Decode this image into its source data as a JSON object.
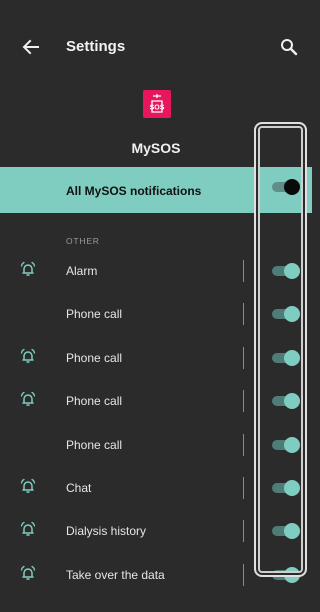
{
  "header": {
    "title": "Settings",
    "back_icon": "arrow-left-icon",
    "search_icon": "search-icon"
  },
  "app": {
    "name": "MySOS",
    "logo_text": "SOS",
    "logo_color": "#e8175d"
  },
  "master": {
    "label": "All MySOS notifications",
    "enabled": true,
    "background": "#7fcdc0"
  },
  "section": {
    "header": "OTHER"
  },
  "channels": [
    {
      "label": "Alarm",
      "bell": true,
      "enabled": true
    },
    {
      "label": "Phone call",
      "bell": false,
      "enabled": true
    },
    {
      "label": "Phone call",
      "bell": true,
      "enabled": true
    },
    {
      "label": "Phone call",
      "bell": true,
      "enabled": true
    },
    {
      "label": "Phone call",
      "bell": false,
      "enabled": true
    },
    {
      "label": "Chat",
      "bell": true,
      "enabled": true
    },
    {
      "label": "Dialysis history",
      "bell": true,
      "enabled": true
    },
    {
      "label": "Take over the data",
      "bell": true,
      "enabled": true
    }
  ],
  "colors": {
    "accent": "#7fcdc0",
    "background": "#2b2b2b"
  }
}
